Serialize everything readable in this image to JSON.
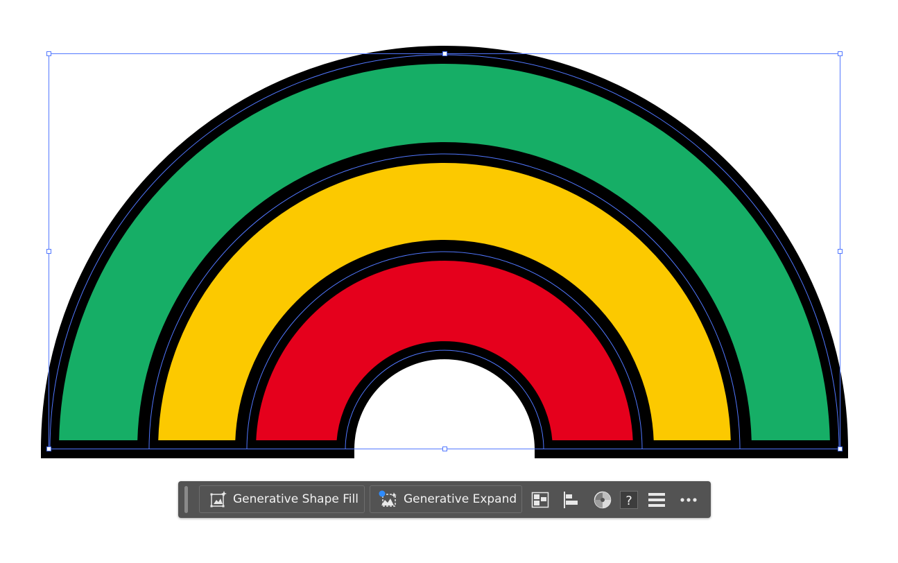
{
  "canvas": {
    "arc_colors": {
      "outer": "#16ae66",
      "middle": "#fcc900",
      "inner": "#e5001c",
      "stroke": "#000000",
      "selection": "#5177ff"
    }
  },
  "contextual_taskbar": {
    "buttons": [
      {
        "label": "Generative Shape Fill",
        "icon": "generative-shape-fill-icon"
      },
      {
        "label": "Generative Expand",
        "icon": "generative-expand-icon"
      }
    ],
    "icons": [
      "arrange-icon",
      "align-left-icon",
      "recolor-icon",
      "help-icon",
      "properties-menu-icon",
      "more-options-icon"
    ],
    "colors": {
      "background": "#535353",
      "text": "#f2f2f2",
      "badge": "#2f8cff"
    }
  }
}
